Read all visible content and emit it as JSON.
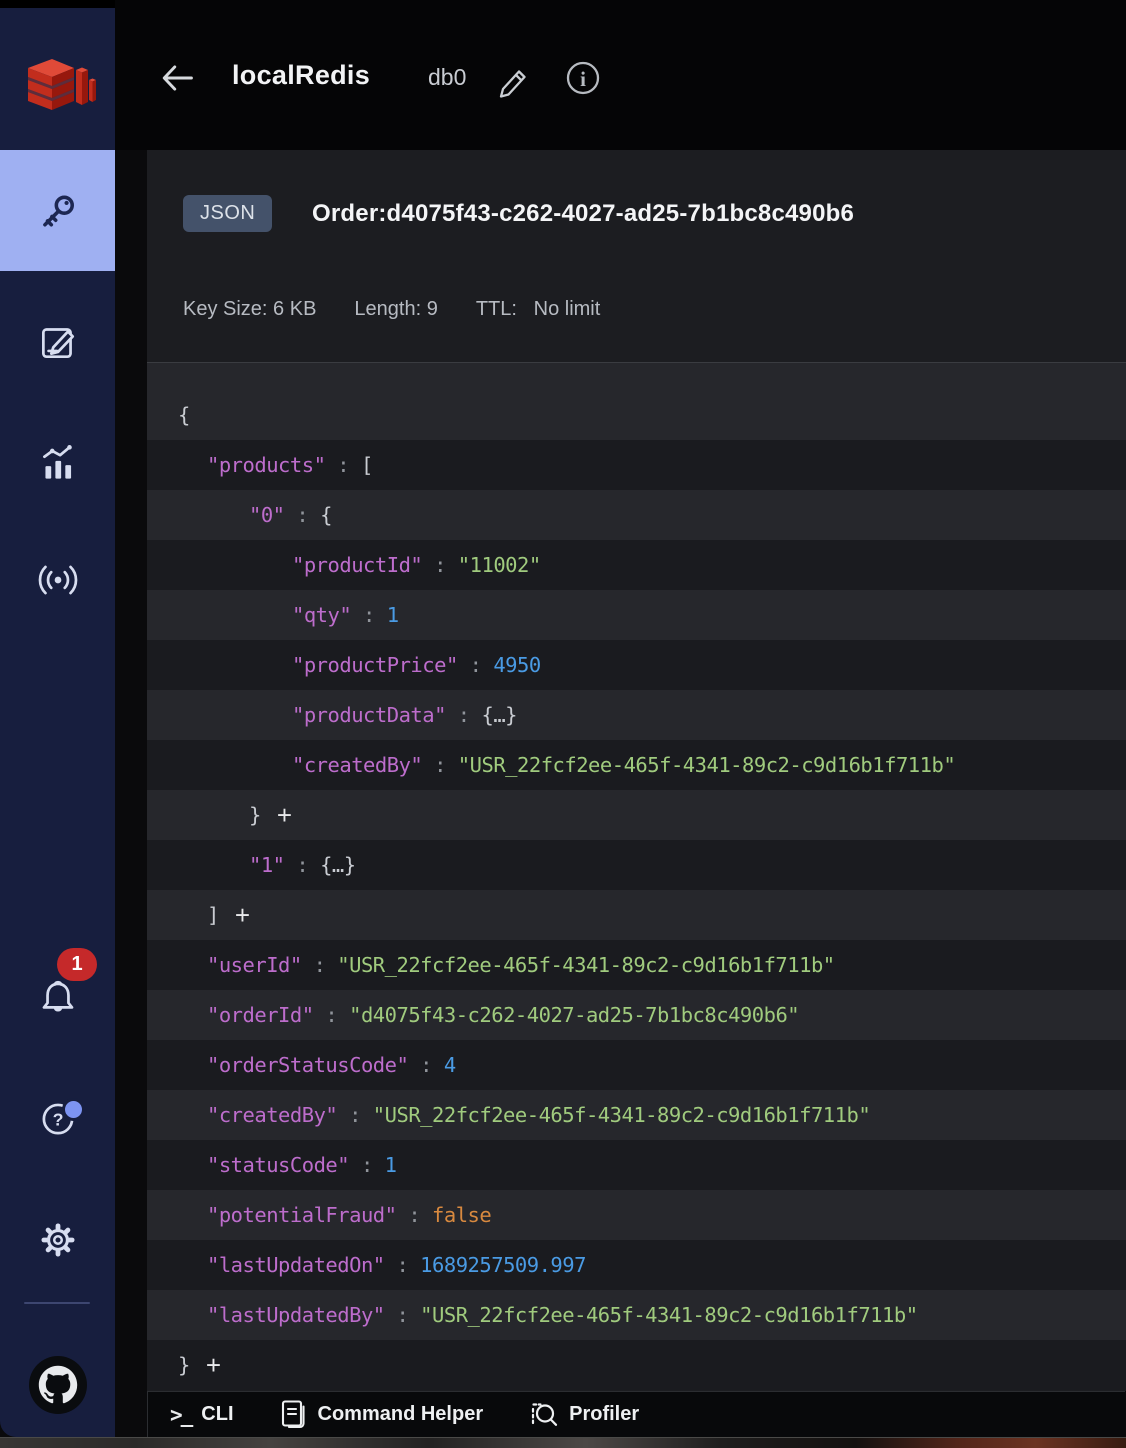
{
  "header": {
    "connection_name": "localRedis",
    "database": "db0"
  },
  "key_details": {
    "type_badge": "JSON",
    "key_name": "Order:d4075f43-c262-4027-ad25-7b1bc8c490b6",
    "meta": {
      "key_size_label": "Key Size:",
      "key_size_value": "6 KB",
      "length_label": "Length:",
      "length_value": "9",
      "ttl_label": "TTL:",
      "ttl_value": "No limit"
    }
  },
  "json_rows": [
    {
      "indent": 0,
      "tokens": [
        {
          "t": "{",
          "c": "punct"
        }
      ]
    },
    {
      "indent": 1,
      "tokens": [
        {
          "t": "\"products\"",
          "c": "key"
        },
        {
          "t": " : ",
          "c": "colon"
        },
        {
          "t": "[",
          "c": "punct"
        }
      ]
    },
    {
      "indent": 2,
      "tokens": [
        {
          "t": "\"0\"",
          "c": "key"
        },
        {
          "t": " : ",
          "c": "colon"
        },
        {
          "t": "{",
          "c": "punct"
        }
      ]
    },
    {
      "indent": 3,
      "tokens": [
        {
          "t": "\"productId\"",
          "c": "key"
        },
        {
          "t": " : ",
          "c": "colon"
        },
        {
          "t": "\"11002\"",
          "c": "str"
        }
      ]
    },
    {
      "indent": 3,
      "tokens": [
        {
          "t": "\"qty\"",
          "c": "key"
        },
        {
          "t": " : ",
          "c": "colon"
        },
        {
          "t": "1",
          "c": "num"
        }
      ]
    },
    {
      "indent": 3,
      "tokens": [
        {
          "t": "\"productPrice\"",
          "c": "key"
        },
        {
          "t": " : ",
          "c": "colon"
        },
        {
          "t": "4950",
          "c": "num"
        }
      ]
    },
    {
      "indent": 3,
      "tokens": [
        {
          "t": "\"productData\"",
          "c": "key"
        },
        {
          "t": " : ",
          "c": "colon"
        },
        {
          "t": "{…}",
          "c": "punct"
        }
      ]
    },
    {
      "indent": 3,
      "tokens": [
        {
          "t": "\"createdBy\"",
          "c": "key"
        },
        {
          "t": " : ",
          "c": "colon"
        },
        {
          "t": "\"USR_22fcf2ee-465f-4341-89c2-c9d16b1f711b\"",
          "c": "str"
        }
      ]
    },
    {
      "indent": 2,
      "tokens": [
        {
          "t": "}",
          "c": "punct"
        },
        {
          "t": "+",
          "c": "plus"
        }
      ]
    },
    {
      "indent": 2,
      "tokens": [
        {
          "t": "\"1\"",
          "c": "key"
        },
        {
          "t": " : ",
          "c": "colon"
        },
        {
          "t": "{…}",
          "c": "punct"
        }
      ]
    },
    {
      "indent": 1,
      "tokens": [
        {
          "t": "]",
          "c": "punct"
        },
        {
          "t": "+",
          "c": "plus"
        }
      ]
    },
    {
      "indent": 1,
      "tokens": [
        {
          "t": "\"userId\"",
          "c": "key"
        },
        {
          "t": " : ",
          "c": "colon"
        },
        {
          "t": "\"USR_22fcf2ee-465f-4341-89c2-c9d16b1f711b\"",
          "c": "str"
        }
      ]
    },
    {
      "indent": 1,
      "tokens": [
        {
          "t": "\"orderId\"",
          "c": "key"
        },
        {
          "t": " : ",
          "c": "colon"
        },
        {
          "t": "\"d4075f43-c262-4027-ad25-7b1bc8c490b6\"",
          "c": "str"
        }
      ]
    },
    {
      "indent": 1,
      "tokens": [
        {
          "t": "\"orderStatusCode\"",
          "c": "key"
        },
        {
          "t": " : ",
          "c": "colon"
        },
        {
          "t": "4",
          "c": "num"
        }
      ]
    },
    {
      "indent": 1,
      "tokens": [
        {
          "t": "\"createdBy\"",
          "c": "key"
        },
        {
          "t": " : ",
          "c": "colon"
        },
        {
          "t": "\"USR_22fcf2ee-465f-4341-89c2-c9d16b1f711b\"",
          "c": "str"
        }
      ]
    },
    {
      "indent": 1,
      "tokens": [
        {
          "t": "\"statusCode\"",
          "c": "key"
        },
        {
          "t": " : ",
          "c": "colon"
        },
        {
          "t": "1",
          "c": "num"
        }
      ]
    },
    {
      "indent": 1,
      "tokens": [
        {
          "t": "\"potentialFraud\"",
          "c": "key"
        },
        {
          "t": " : ",
          "c": "colon"
        },
        {
          "t": "false",
          "c": "bool"
        }
      ]
    },
    {
      "indent": 1,
      "tokens": [
        {
          "t": "\"lastUpdatedOn\"",
          "c": "key"
        },
        {
          "t": " : ",
          "c": "colon"
        },
        {
          "t": "1689257509.997",
          "c": "num"
        }
      ]
    },
    {
      "indent": 1,
      "tokens": [
        {
          "t": "\"lastUpdatedBy\"",
          "c": "key"
        },
        {
          "t": " : ",
          "c": "colon"
        },
        {
          "t": "\"USR_22fcf2ee-465f-4341-89c2-c9d16b1f711b\"",
          "c": "str"
        }
      ]
    },
    {
      "indent": 0,
      "tokens": [
        {
          "t": "}",
          "c": "punct"
        },
        {
          "t": "+",
          "c": "plus"
        }
      ]
    }
  ],
  "sidebar": {
    "notification_badge": "1",
    "icons": [
      "redis-logo",
      "browser-keys",
      "workbench",
      "analytics",
      "pub-sub",
      "notifications",
      "help",
      "settings",
      "github"
    ]
  },
  "bottom_bar": {
    "cli_label": "CLI",
    "command_helper_label": "Command Helper",
    "profiler_label": "Profiler"
  },
  "colors": {
    "sidebar_bg": "#171e3e",
    "sidebar_selected": "#9fb0f2",
    "json_key": "#bd6dcc",
    "json_string": "#a0cb7e",
    "json_number": "#4a9be4",
    "json_boolean": "#d8893f",
    "row_light": "#26272c",
    "row_dark": "#1a1b1f",
    "badge_bg": "#44526a",
    "notification_red": "#c5292a"
  }
}
